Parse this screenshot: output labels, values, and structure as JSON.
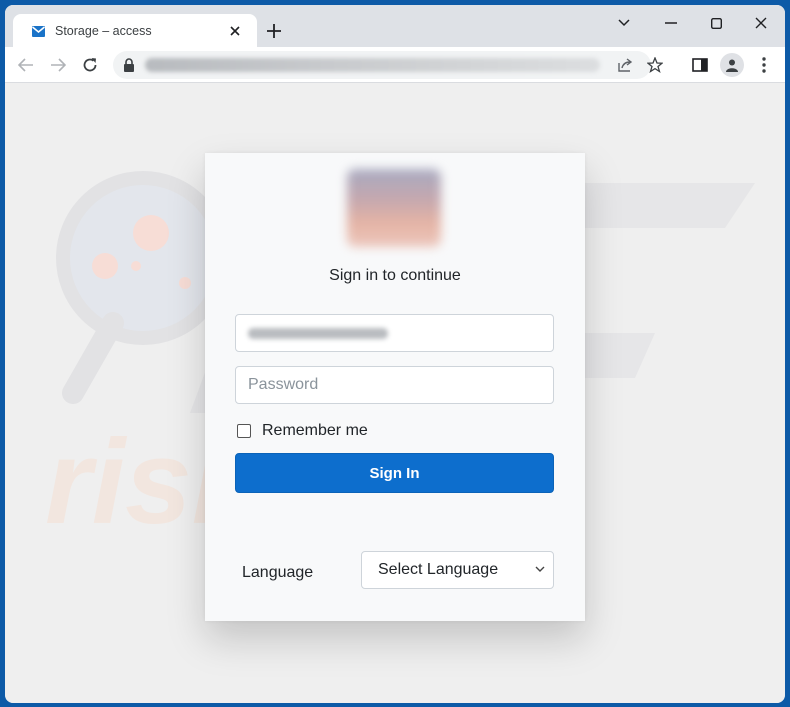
{
  "browser": {
    "tab": {
      "title": "Storage – access",
      "favicon": "envelope-icon",
      "close_icon": "close-icon"
    },
    "new_tab_icon": "plus-icon",
    "window_controls": {
      "tab_search": "chevron-down-icon",
      "minimize": "minimize-icon",
      "maximize": "maximize-icon",
      "close": "close-icon"
    },
    "toolbar": {
      "back": "arrow-left-icon",
      "forward": "arrow-right-icon",
      "reload": "reload-icon",
      "lock": "lock-icon",
      "url": "(blurred URL)",
      "share": "share-icon",
      "bookmark": "star-icon",
      "side_panel": "side-panel-icon",
      "profile": "profile-icon",
      "menu": "kebab-menu-icon"
    }
  },
  "page": {
    "heading": "Sign in to continue",
    "email": {
      "value": "(blurred email)"
    },
    "password": {
      "placeholder": "Password"
    },
    "remember_me": {
      "label": "Remember me",
      "checked": false
    },
    "signin_button": "Sign In",
    "language": {
      "label": "Language",
      "selected": "Select Language"
    },
    "colors": {
      "primary": "#0d6ecd",
      "window_frame": "#0d5aa7"
    }
  }
}
